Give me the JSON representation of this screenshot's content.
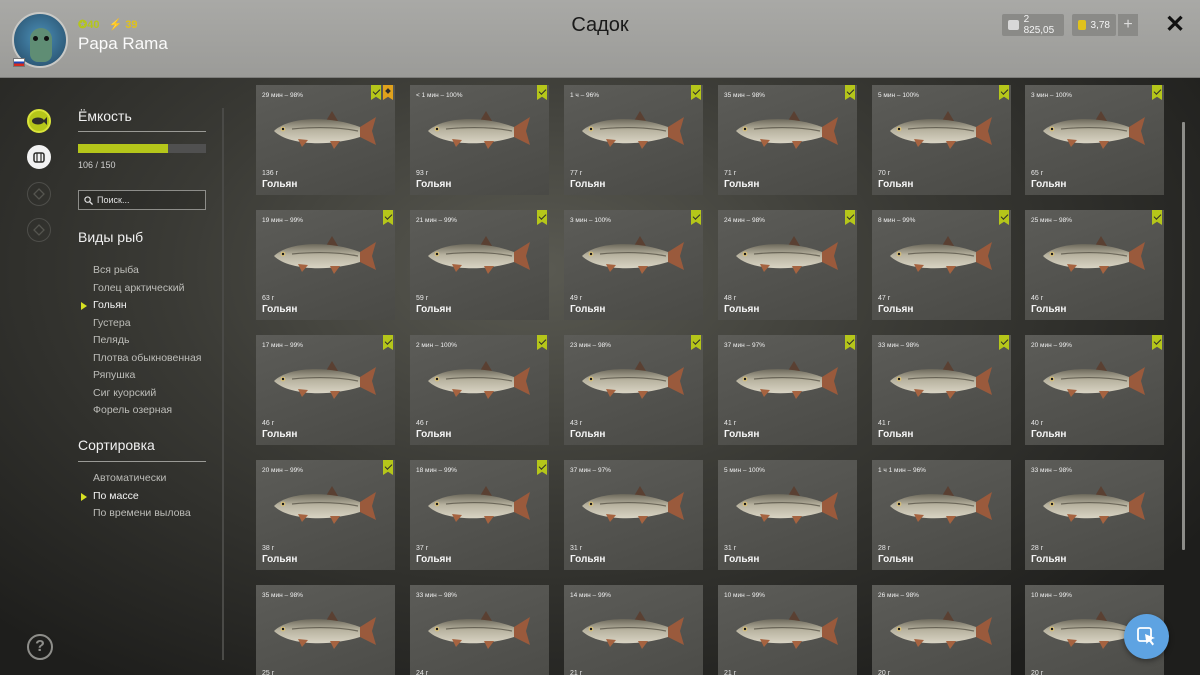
{
  "header": {
    "title": "Садок",
    "username": "Papa Rama",
    "level": "40",
    "energy": "39",
    "silver": "2 825,05",
    "gold": "3,78",
    "plus_label": "+",
    "close_label": "✕"
  },
  "colors": {
    "accent": "#b5c61a",
    "star": "#e0a21c",
    "fab": "#5ea3e2"
  },
  "sidebar_icons": [
    "fish-icon",
    "cage-icon",
    "locked-slot-icon",
    "locked-slot-icon"
  ],
  "capacity": {
    "heading": "Ёмкость",
    "used": 106,
    "total": 150,
    "label": "106 / 150"
  },
  "search": {
    "placeholder": "Поиск..."
  },
  "species": {
    "heading": "Виды рыб",
    "items": [
      "Вся рыба",
      "Голец арктический",
      "Гольян",
      "Густера",
      "Пелядь",
      "Плотва обыкновенная",
      "Ряпушка",
      "Сиг куорский",
      "Форель озерная"
    ],
    "selected_index": 2
  },
  "sorting": {
    "heading": "Сортировка",
    "items": [
      "Автоматически",
      "По массе",
      "По времени вылова"
    ],
    "selected_index": 1
  },
  "help_label": "?",
  "fish_cards": [
    {
      "time": "29 мин – 98%",
      "weight": "136 г",
      "name": "Гольян",
      "badges": [
        "check",
        "star"
      ]
    },
    {
      "time": "< 1 мин – 100%",
      "weight": "93 г",
      "name": "Гольян",
      "badges": [
        "check"
      ]
    },
    {
      "time": "1 ч – 96%",
      "weight": "77 г",
      "name": "Гольян",
      "badges": [
        "check"
      ]
    },
    {
      "time": "35 мин – 98%",
      "weight": "71 г",
      "name": "Гольян",
      "badges": [
        "check"
      ]
    },
    {
      "time": "5 мин – 100%",
      "weight": "70 г",
      "name": "Гольян",
      "badges": [
        "check"
      ]
    },
    {
      "time": "3 мин – 100%",
      "weight": "65 г",
      "name": "Гольян",
      "badges": [
        "check"
      ]
    },
    {
      "time": "19 мин – 99%",
      "weight": "63 г",
      "name": "Гольян",
      "badges": [
        "check"
      ]
    },
    {
      "time": "21 мин – 99%",
      "weight": "59 г",
      "name": "Гольян",
      "badges": [
        "check"
      ]
    },
    {
      "time": "3 мин – 100%",
      "weight": "49 г",
      "name": "Гольян",
      "badges": [
        "check"
      ]
    },
    {
      "time": "24 мин – 98%",
      "weight": "48 г",
      "name": "Гольян",
      "badges": [
        "check"
      ]
    },
    {
      "time": "8 мин – 99%",
      "weight": "47 г",
      "name": "Гольян",
      "badges": [
        "check"
      ]
    },
    {
      "time": "25 мин – 98%",
      "weight": "46 г",
      "name": "Гольян",
      "badges": [
        "check"
      ]
    },
    {
      "time": "17 мин – 99%",
      "weight": "46 г",
      "name": "Гольян",
      "badges": [
        "check"
      ]
    },
    {
      "time": "2 мин – 100%",
      "weight": "46 г",
      "name": "Гольян",
      "badges": [
        "check"
      ]
    },
    {
      "time": "23 мин – 98%",
      "weight": "43 г",
      "name": "Гольян",
      "badges": [
        "check"
      ]
    },
    {
      "time": "37 мин – 97%",
      "weight": "41 г",
      "name": "Гольян",
      "badges": [
        "check"
      ]
    },
    {
      "time": "33 мин – 98%",
      "weight": "41 г",
      "name": "Гольян",
      "badges": [
        "check"
      ]
    },
    {
      "time": "20 мин – 99%",
      "weight": "40 г",
      "name": "Гольян",
      "badges": [
        "check"
      ]
    },
    {
      "time": "20 мин – 99%",
      "weight": "38 г",
      "name": "Гольян",
      "badges": [
        "check"
      ]
    },
    {
      "time": "18 мин – 99%",
      "weight": "37 г",
      "name": "Гольян",
      "badges": [
        "check"
      ]
    },
    {
      "time": "37 мин – 97%",
      "weight": "31 г",
      "name": "Гольян",
      "badges": []
    },
    {
      "time": "5 мин – 100%",
      "weight": "31 г",
      "name": "Гольян",
      "badges": []
    },
    {
      "time": "1 ч 1 мин – 96%",
      "weight": "28 г",
      "name": "Гольян",
      "badges": []
    },
    {
      "time": "33 мин – 98%",
      "weight": "28 г",
      "name": "Гольян",
      "badges": []
    },
    {
      "time": "35 мин – 98%",
      "weight": "25 г",
      "name": "Гольян",
      "badges": []
    },
    {
      "time": "33 мин – 98%",
      "weight": "24 г",
      "name": "Гольян",
      "badges": []
    },
    {
      "time": "14 мин – 99%",
      "weight": "21 г",
      "name": "Гольян",
      "badges": []
    },
    {
      "time": "10 мин – 99%",
      "weight": "21 г",
      "name": "Гольян",
      "badges": []
    },
    {
      "time": "26 мин – 98%",
      "weight": "20 г",
      "name": "Гольян",
      "badges": []
    },
    {
      "time": "10 мин – 99%",
      "weight": "20 г",
      "name": "Гольян",
      "badges": []
    }
  ]
}
